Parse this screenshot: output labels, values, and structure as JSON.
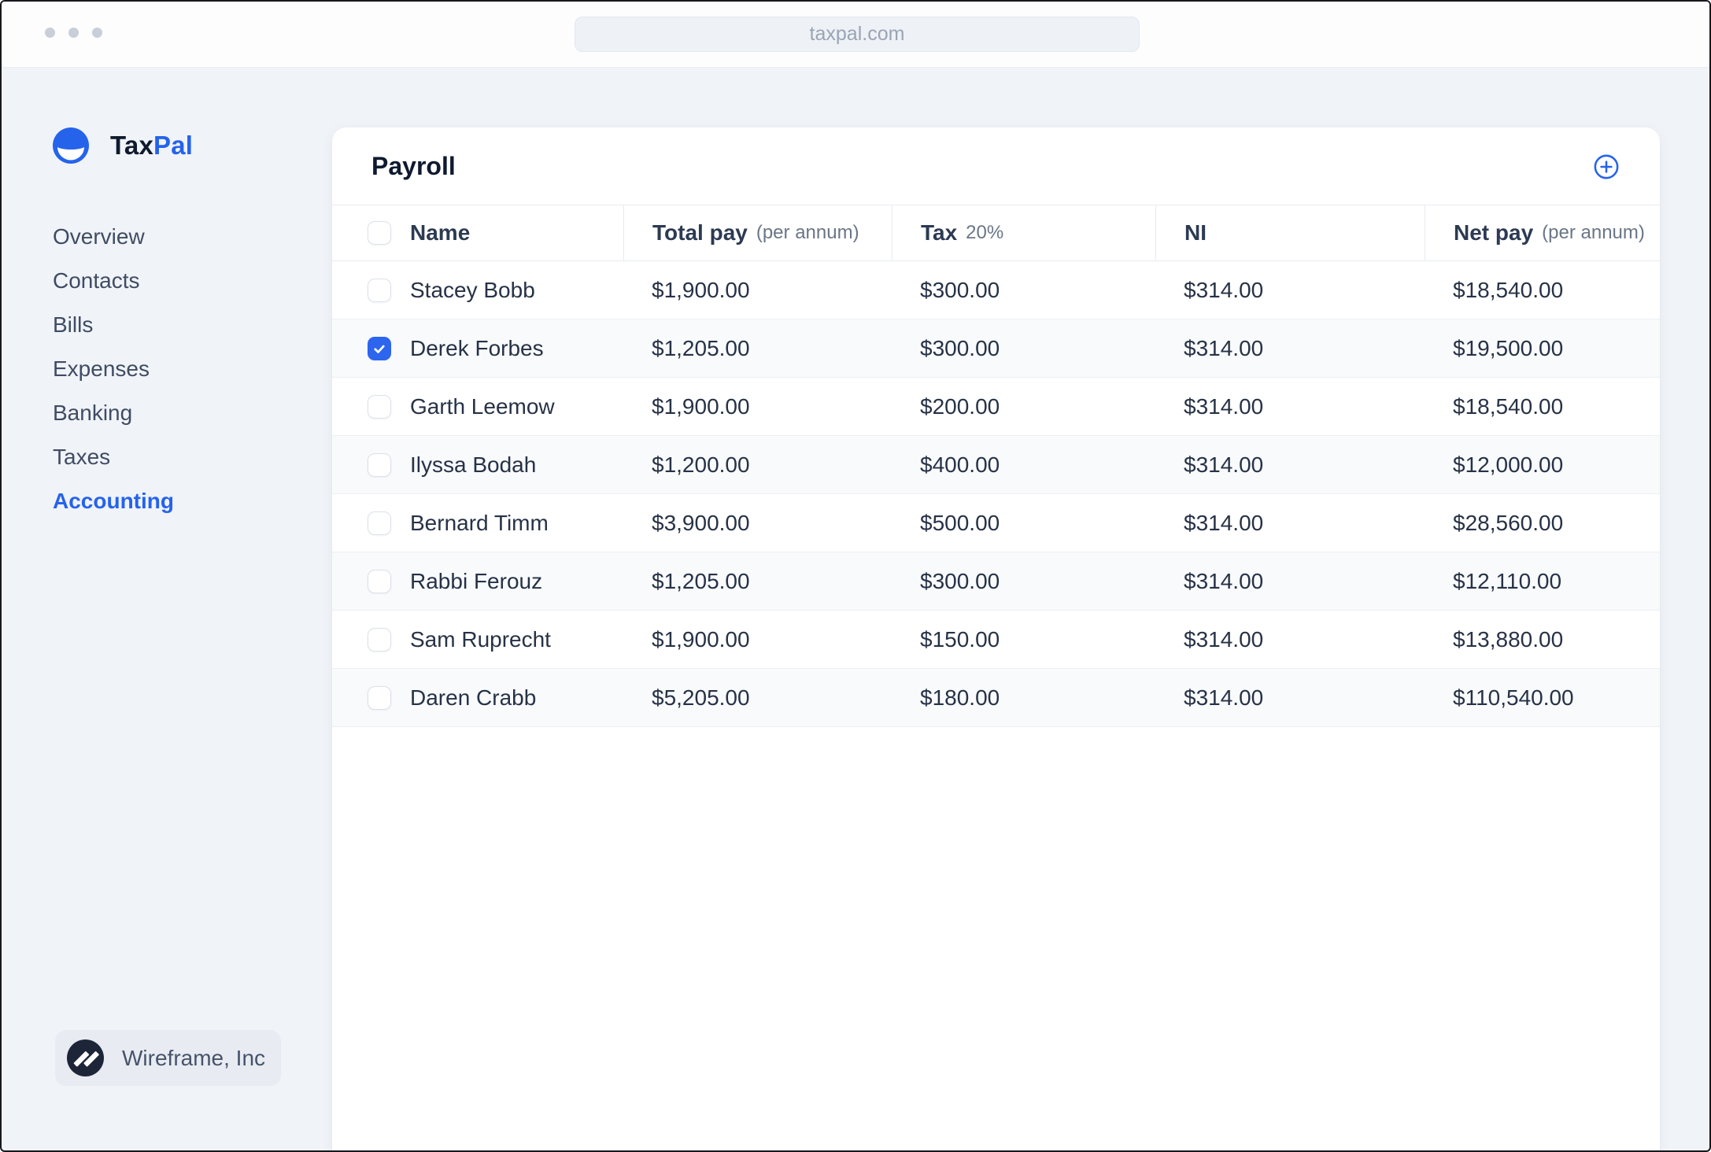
{
  "browser": {
    "url": "taxpal.com"
  },
  "brand": {
    "name_primary": "Tax",
    "name_secondary": "Pal"
  },
  "icons": {
    "brand": "smile-circle",
    "add": "plus-circle",
    "org": "double-slash-circle",
    "checkbox_checked": "checkmark"
  },
  "colors": {
    "accent": "#2563eb",
    "checked_checkbox": "#2d65ee",
    "page_background": "#f0f3f8",
    "zebra_row": "#f8fafc",
    "header_border": "#e7ebf0"
  },
  "sidebar": {
    "items": [
      {
        "label": "Overview",
        "active": false
      },
      {
        "label": "Contacts",
        "active": false
      },
      {
        "label": "Bills",
        "active": false
      },
      {
        "label": "Expenses",
        "active": false
      },
      {
        "label": "Banking",
        "active": false
      },
      {
        "label": "Taxes",
        "active": false
      },
      {
        "label": "Accounting",
        "active": true
      }
    ],
    "org": {
      "name": "Wireframe, Inc"
    }
  },
  "payroll": {
    "title": "Payroll",
    "columns": [
      {
        "label": "Name",
        "sub": ""
      },
      {
        "label": "Total pay",
        "sub": "(per annum)"
      },
      {
        "label": "Tax",
        "sub": "20%"
      },
      {
        "label": "NI",
        "sub": ""
      },
      {
        "label": "Net pay",
        "sub": "(per annum)"
      }
    ],
    "header_checkbox_checked": false,
    "rows": [
      {
        "name": "Stacey Bobb",
        "checked": false,
        "total_pay": "$1,900.00",
        "tax": "$300.00",
        "ni": "$314.00",
        "net_pay": "$18,540.00"
      },
      {
        "name": "Derek Forbes",
        "checked": true,
        "total_pay": "$1,205.00",
        "tax": "$300.00",
        "ni": "$314.00",
        "net_pay": "$19,500.00"
      },
      {
        "name": "Garth Leemow",
        "checked": false,
        "total_pay": "$1,900.00",
        "tax": "$200.00",
        "ni": "$314.00",
        "net_pay": "$18,540.00"
      },
      {
        "name": "Ilyssa Bodah",
        "checked": false,
        "total_pay": "$1,200.00",
        "tax": "$400.00",
        "ni": "$314.00",
        "net_pay": "$12,000.00"
      },
      {
        "name": "Bernard Timm",
        "checked": false,
        "total_pay": "$3,900.00",
        "tax": "$500.00",
        "ni": "$314.00",
        "net_pay": "$28,560.00"
      },
      {
        "name": "Rabbi Ferouz",
        "checked": false,
        "total_pay": "$1,205.00",
        "tax": "$300.00",
        "ni": "$314.00",
        "net_pay": "$12,110.00"
      },
      {
        "name": "Sam Ruprecht",
        "checked": false,
        "total_pay": "$1,900.00",
        "tax": "$150.00",
        "ni": "$314.00",
        "net_pay": "$13,880.00"
      },
      {
        "name": "Daren Crabb",
        "checked": false,
        "total_pay": "$5,205.00",
        "tax": "$180.00",
        "ni": "$314.00",
        "net_pay": "$110,540.00"
      }
    ]
  }
}
